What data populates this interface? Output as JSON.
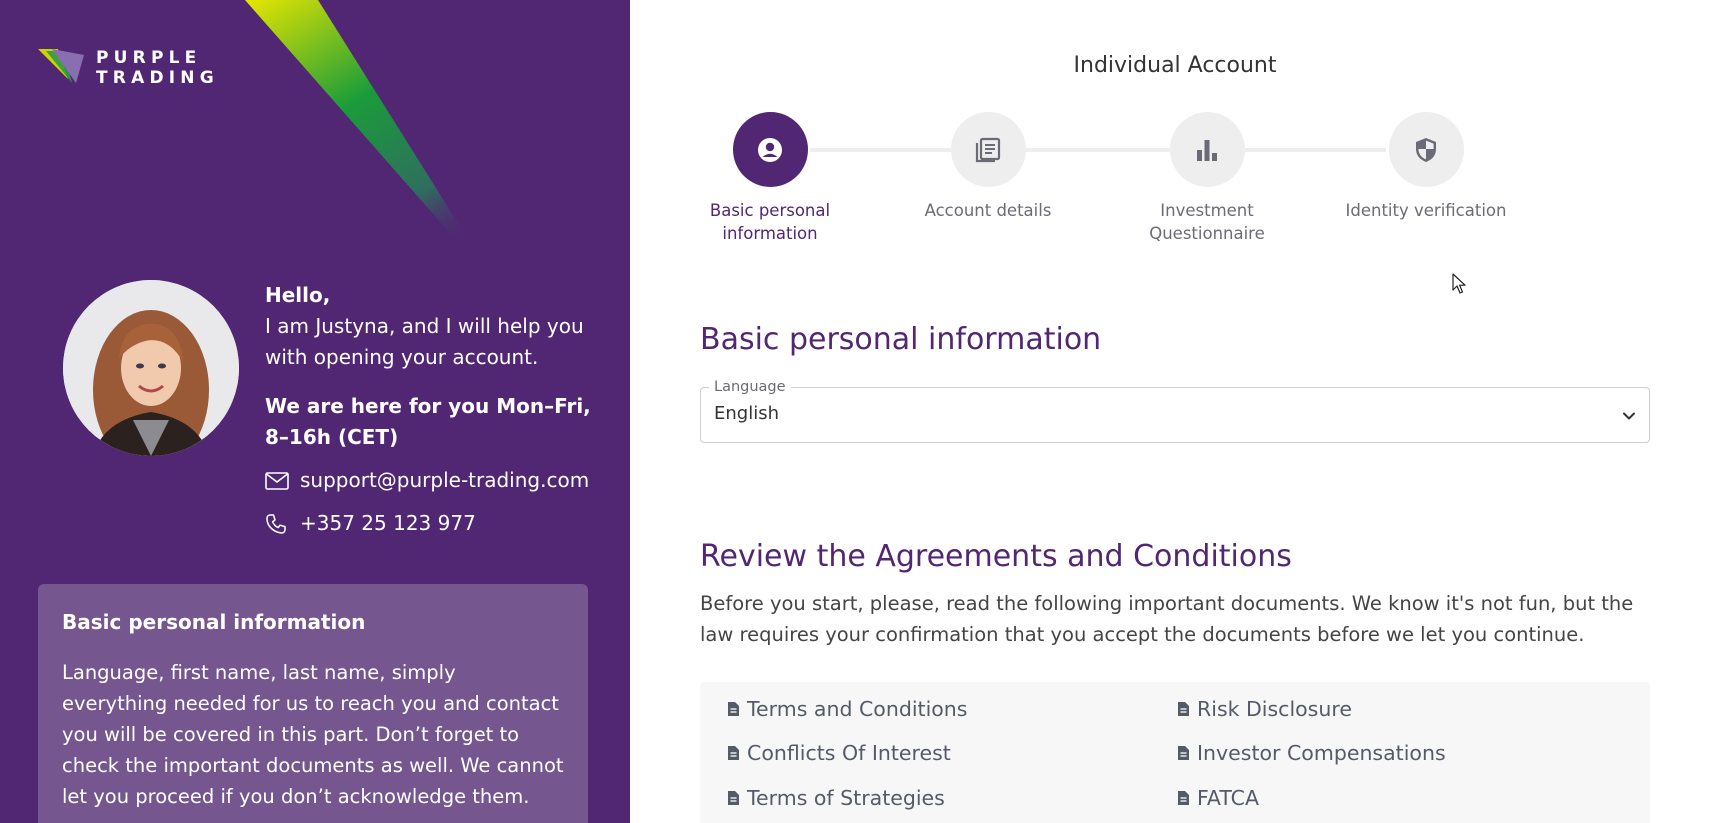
{
  "brand": {
    "line1": "PURPLE",
    "line2": "TRADING"
  },
  "assistant": {
    "hello": "Hello,",
    "intro": "I am Justyna, and I will help you with opening your account.",
    "hours": "We are here for you Mon–Fri, 8–16h (CET)",
    "email": "support@purple-trading.com",
    "phone": "+357 25 123 977"
  },
  "info_box": {
    "title": "Basic personal information",
    "text": "Language, first name, last name, simply everything needed for us to reach you and contact you will be covered in this part. Don’t forget to check the important documents as well. We cannot let you proceed if you don’t acknowledge them."
  },
  "account_title": "Individual Account",
  "steps": [
    {
      "label": "Basic personal information",
      "icon": "person-circle-icon",
      "active": true
    },
    {
      "label": "Account details",
      "icon": "document-list-icon",
      "active": false
    },
    {
      "label": "Investment Questionnaire",
      "icon": "bar-chart-icon",
      "active": false
    },
    {
      "label": "Identity verification",
      "icon": "shield-icon",
      "active": false
    }
  ],
  "basic_section": {
    "heading": "Basic personal information",
    "language_label": "Language",
    "language_value": "English"
  },
  "review_section": {
    "heading": "Review the Agreements and Conditions",
    "text": "Before you start, please, read the following important documents. We know it's not fun, but the law requires your confirmation that you accept the documents before we let you continue."
  },
  "documents": [
    "Terms and Conditions",
    "Risk Disclosure",
    "Conflicts Of Interest",
    "Investor Compensations",
    "Terms of Strategies",
    "FATCA"
  ],
  "colors": {
    "brand_purple": "#512773",
    "info_box": "#76568f",
    "step_inactive": "#eeeeee"
  }
}
